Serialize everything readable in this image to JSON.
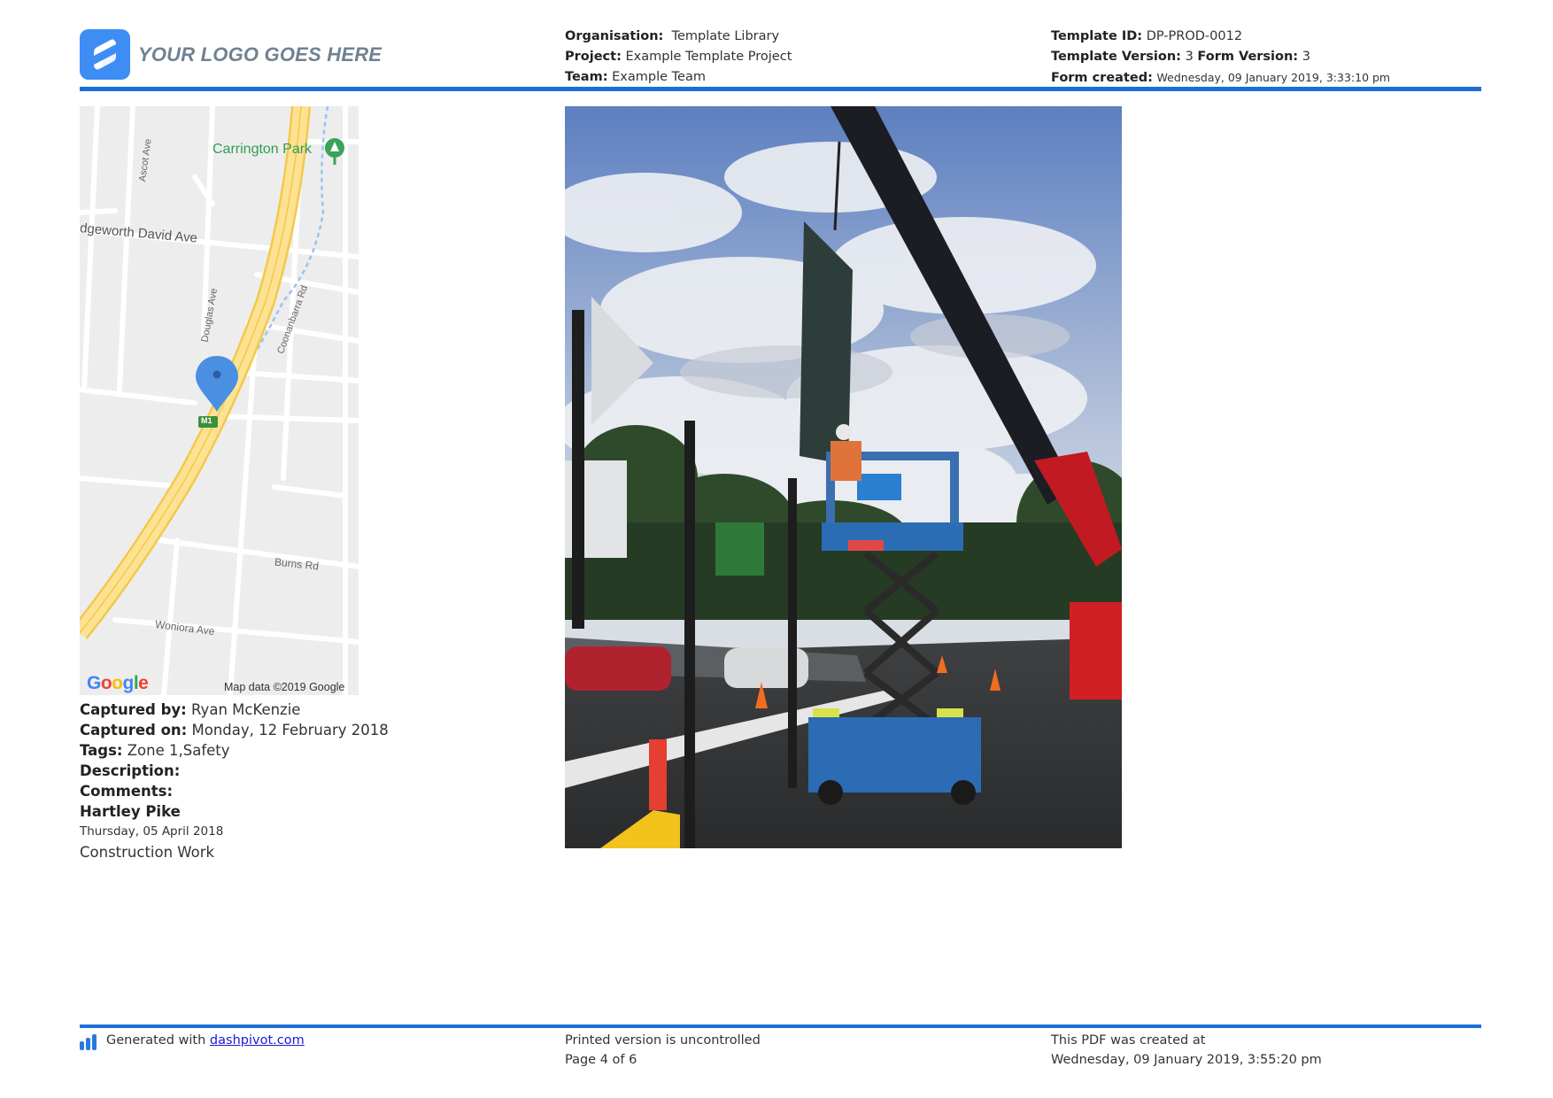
{
  "header": {
    "logo_text": "YOUR LOGO GOES HERE",
    "organisation_label": "Organisation:",
    "organisation_value": "Template Library",
    "project_label": "Project:",
    "project_value": "Example Template Project",
    "team_label": "Team:",
    "team_value": "Example Team",
    "template_id_label": "Template ID:",
    "template_id_value": "DP-PROD-0012",
    "template_version_label": "Template Version:",
    "template_version_value": "3",
    "form_version_label": "Form Version:",
    "form_version_value": "3",
    "form_created_label": "Form created:",
    "form_created_value": "Wednesday, 09 January 2019, 3:33:10 pm"
  },
  "map": {
    "labels": {
      "park": "Carrington Park",
      "ascot": "Ascot Ave",
      "edgeworth": "dgeworth David Ave",
      "douglas": "Douglas Ave",
      "coonanbarra": "Coonanbarra Rd",
      "burns": "Burns Rd",
      "woniora": "Woniora Ave",
      "motorway": "M1"
    },
    "google_logo": "Google",
    "credit": "Map data ©2019 Google"
  },
  "captions": {
    "captured_by_label": "Captured by:",
    "captured_by_value": "Ryan McKenzie",
    "captured_on_label": "Captured on:",
    "captured_on_value": "Monday, 12 February 2018",
    "tags_label": "Tags:",
    "tags_value": "Zone 1,Safety",
    "description_label": "Description:",
    "comments_label": "Comments:",
    "comment_author": "Hartley Pike",
    "comment_date": "Thursday, 05 April 2018",
    "comment_text": "Construction Work"
  },
  "footer": {
    "generated_prefix": "Generated with",
    "generated_link": "dashpivot.com",
    "uncontrolled": "Printed version is uncontrolled",
    "page": "Page 4 of 6",
    "pdf_created_label": "This PDF was created at",
    "pdf_created_value": "Wednesday, 09 January 2019, 3:55:20 pm"
  },
  "colors": {
    "accent": "#1a6fd6",
    "logo_mark": "#3d8df5",
    "link": "#1a1ad6"
  },
  "icons": [
    "logo-mark-icon",
    "map-pin-icon",
    "park-tree-icon",
    "dashpivot-bars-icon"
  ]
}
